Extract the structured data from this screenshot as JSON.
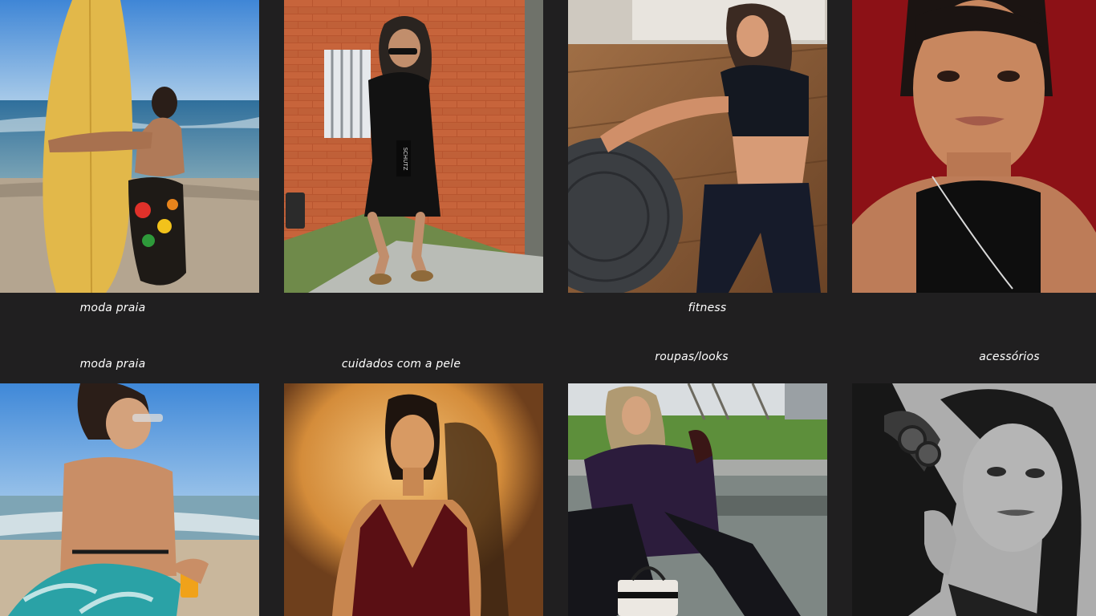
{
  "gallery": {
    "top_row": [
      {
        "caption": "moda praia"
      },
      {
        "caption": ""
      },
      {
        "caption": "fitness"
      },
      {
        "caption": ""
      }
    ],
    "bottom_row": [
      {
        "caption": "moda praia"
      },
      {
        "caption": "cuidados com a pele"
      },
      {
        "caption": "roupas/looks"
      },
      {
        "caption": "acessórios"
      }
    ],
    "bag_tag": "SCHUTZ"
  },
  "colors": {
    "background": "#201f20",
    "caption_text": "#ffffff"
  }
}
